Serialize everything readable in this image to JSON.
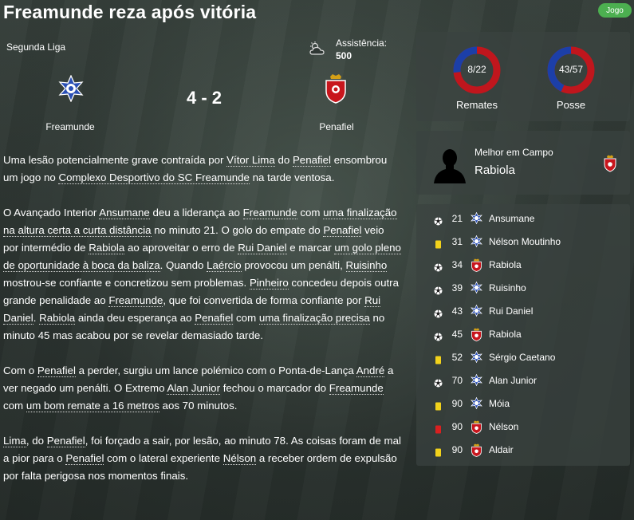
{
  "header": {
    "title": "Freamunde reza após vitória",
    "badge": "Jogo"
  },
  "match": {
    "league": "Segunda Liga",
    "attendance_label": "Assistência:",
    "attendance_value": "500",
    "score": "4 - 2",
    "home": "Freamunde",
    "away": "Penafiel"
  },
  "stats": {
    "shots": {
      "text": "8/22",
      "label": "Remates",
      "home": 8,
      "away": 22
    },
    "possession": {
      "text": "43/57",
      "label": "Posse",
      "home": 43,
      "away": 57
    },
    "home_color": "#1c3fa8",
    "away_color": "#c0161d"
  },
  "motm": {
    "label": "Melhor em Campo",
    "name": "Rabiola"
  },
  "report": [
    [
      {
        "t": "Uma lesão potencialmente grave contraída por "
      },
      {
        "t": "Vítor Lima",
        "u": true
      },
      {
        "t": " do "
      },
      {
        "t": "Penafiel",
        "u": true
      },
      {
        "t": " ensombrou um jogo no "
      },
      {
        "t": "Complexo Desportivo do SC Freamunde",
        "u": true
      },
      {
        "t": " na tarde ventosa."
      }
    ],
    [
      {
        "t": "O Avançado Interior "
      },
      {
        "t": "Ansumane",
        "u": true
      },
      {
        "t": " deu a liderança ao "
      },
      {
        "t": "Freamunde",
        "u": true
      },
      {
        "t": " com "
      },
      {
        "t": "uma finalização na altura certa a curta distância",
        "u": true
      },
      {
        "t": " no minuto 21. O golo do empate do "
      },
      {
        "t": "Penafiel",
        "u": true
      },
      {
        "t": " veio por intermédio de "
      },
      {
        "t": "Rabiola",
        "u": true
      },
      {
        "t": " ao aproveitar o erro de "
      },
      {
        "t": "Rui Daniel",
        "u": true
      },
      {
        "t": " e marcar "
      },
      {
        "t": "um golo pleno de oportunidade à boca da baliza",
        "u": true
      },
      {
        "t": ". Quando "
      },
      {
        "t": "Laércio",
        "u": true
      },
      {
        "t": " provocou um penálti, "
      },
      {
        "t": "Ruisinho",
        "u": true
      },
      {
        "t": " mostrou-se confiante e concretizou sem problemas. "
      },
      {
        "t": "Pinheiro",
        "u": true
      },
      {
        "t": " concedeu depois outra grande penalidade ao "
      },
      {
        "t": "Freamunde",
        "u": true
      },
      {
        "t": ", que foi convertida de forma confiante por "
      },
      {
        "t": "Rui Daniel",
        "u": true
      },
      {
        "t": ". "
      },
      {
        "t": "Rabiola",
        "u": true
      },
      {
        "t": " ainda deu esperança ao "
      },
      {
        "t": "Penafiel",
        "u": true
      },
      {
        "t": " com "
      },
      {
        "t": "uma finalização precisa",
        "u": true
      },
      {
        "t": " no minuto 45 mas acabou por se revelar demasiado tarde."
      }
    ],
    [
      {
        "t": "Com o "
      },
      {
        "t": "Penafiel",
        "u": true
      },
      {
        "t": " a perder, surgiu um lance polémico com o Ponta-de-Lança "
      },
      {
        "t": "André",
        "u": true
      },
      {
        "t": " a ver negado um penálti. O Extremo "
      },
      {
        "t": "Alan Junior",
        "u": true
      },
      {
        "t": " fechou o marcador do "
      },
      {
        "t": "Freamunde",
        "u": true
      },
      {
        "t": " com "
      },
      {
        "t": "um bom remate a 16 metros",
        "u": true
      },
      {
        "t": " aos 70 minutos."
      }
    ],
    [
      {
        "t": "Lima",
        "u": true
      },
      {
        "t": ", do "
      },
      {
        "t": "Penafiel",
        "u": true
      },
      {
        "t": ", foi forçado a sair, por lesão, ao minuto 78. As coisas foram de mal a pior para o "
      },
      {
        "t": "Penafiel",
        "u": true
      },
      {
        "t": " com o lateral experiente "
      },
      {
        "t": "Nélson",
        "u": true
      },
      {
        "t": " a receber ordem de expulsão por falta perigosa nos momentos finais."
      }
    ]
  ],
  "events": [
    {
      "type": "goal",
      "min": "21",
      "team": "home",
      "player": "Ansumane"
    },
    {
      "type": "yellow",
      "min": "31",
      "team": "home",
      "player": "Nélson Moutinho"
    },
    {
      "type": "goal",
      "min": "34",
      "team": "away",
      "player": "Rabiola"
    },
    {
      "type": "goal",
      "min": "39",
      "team": "home",
      "player": "Ruisinho"
    },
    {
      "type": "goal",
      "min": "43",
      "team": "home",
      "player": "Rui Daniel"
    },
    {
      "type": "goal",
      "min": "45",
      "team": "away",
      "player": "Rabiola"
    },
    {
      "type": "yellow",
      "min": "52",
      "team": "home",
      "player": "Sérgio Caetano"
    },
    {
      "type": "goal",
      "min": "70",
      "team": "home",
      "player": "Alan Junior"
    },
    {
      "type": "yellow",
      "min": "90",
      "team": "home",
      "player": "Móia"
    },
    {
      "type": "red",
      "min": "90",
      "team": "away",
      "player": "Nélson"
    },
    {
      "type": "yellow",
      "min": "90",
      "team": "away",
      "player": "Aldair"
    }
  ]
}
